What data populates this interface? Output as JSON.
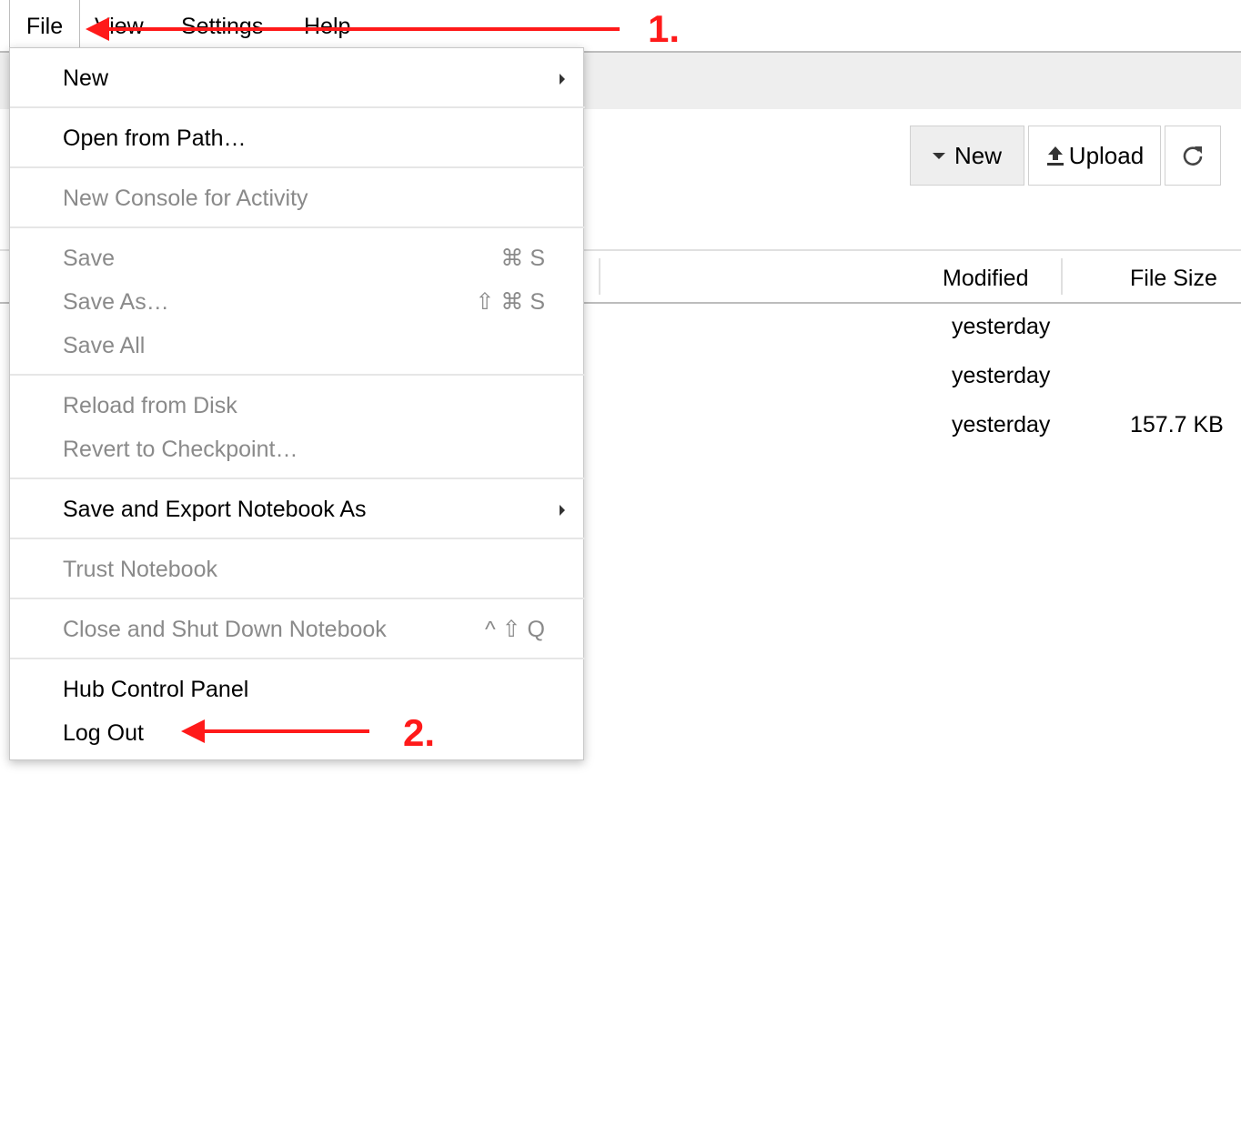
{
  "menubar": {
    "items": [
      "File",
      "View",
      "Settings",
      "Help"
    ]
  },
  "toolbar": {
    "new_label": "New",
    "upload_label": "Upload"
  },
  "file_list": {
    "columns": [
      "Modified",
      "File Size"
    ],
    "rows": [
      {
        "modified": "yesterday",
        "size": ""
      },
      {
        "modified": "yesterday",
        "size": ""
      },
      {
        "modified": "yesterday",
        "size": "157.7 KB"
      }
    ]
  },
  "file_menu": {
    "new": "New",
    "open_from_path": "Open from Path…",
    "new_console": "New Console for Activity",
    "save": "Save",
    "save_shortcut": "⌘ S",
    "save_as": "Save As…",
    "save_as_shortcut": "⇧ ⌘ S",
    "save_all": "Save All",
    "reload": "Reload from Disk",
    "revert": "Revert to Checkpoint…",
    "save_export": "Save and Export Notebook As",
    "trust": "Trust Notebook",
    "close_shutdown": "Close and Shut Down Notebook",
    "close_shortcut": "^ ⇧ Q",
    "hub_panel": "Hub Control Panel",
    "log_out": "Log Out"
  },
  "annotations": {
    "step1": "1.",
    "step2": "2."
  },
  "colors": {
    "annotation": "#ff1a1a",
    "disabled_text": "#8a8a8a"
  }
}
